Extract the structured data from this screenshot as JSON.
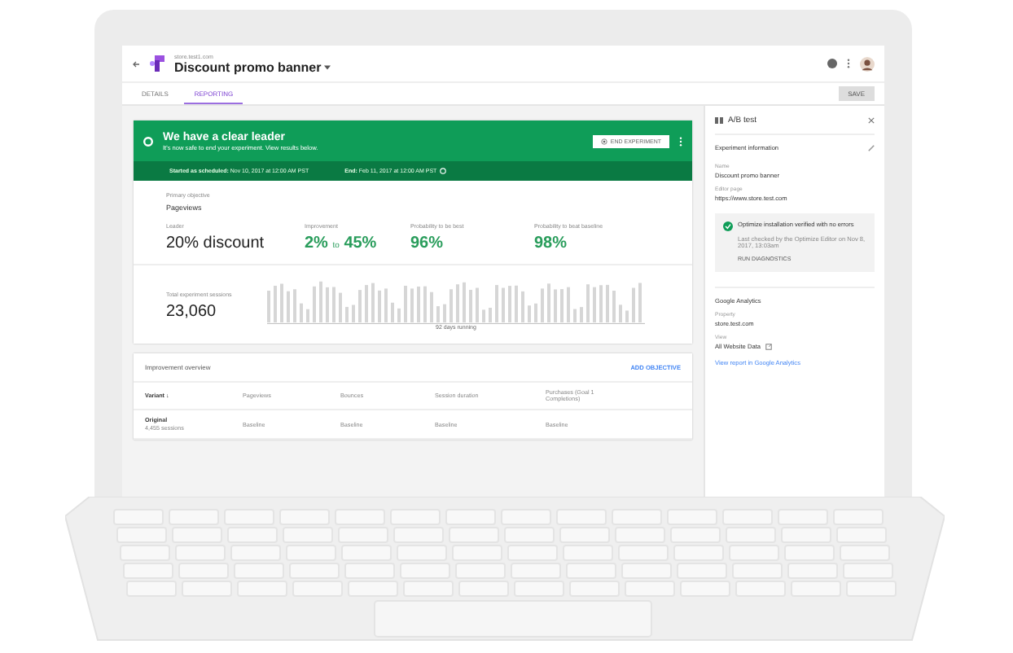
{
  "header": {
    "site": "store.test1.com",
    "title": "Discount promo banner"
  },
  "tabs": [
    {
      "label": "DETAILS",
      "selected": false
    },
    {
      "label": "REPORTING",
      "selected": true
    }
  ],
  "save_button": "SAVE",
  "status_banner": {
    "title": "We have a clear leader",
    "subtitle": "It's now safe to end your experiment. View results below.",
    "end_button": "END EXPERIMENT",
    "started_label": "Started as scheduled:",
    "started": "Nov 10, 2017 at 12:00 AM PST",
    "end_label": "End:",
    "end": "Feb 11, 2017 at 12:00 AM PST"
  },
  "summary": {
    "objective_label": "Primary objective",
    "objective": "Pageviews",
    "leader_label": "Leader",
    "leader": "20% discount",
    "improvement_label": "Improvement",
    "improvement_low": "2%",
    "improvement_joiner": "to",
    "improvement_high": "45%",
    "best_label": "Probability to be best",
    "best": "96%",
    "beat_label": "Probability to beat baseline",
    "beat": "98%",
    "sessions_label": "Total experiment sessions",
    "sessions": "23,060",
    "days": "92 days running"
  },
  "overview": {
    "title": "Improvement overview",
    "action": "ADD OBJECTIVE",
    "columns": [
      "Variant ↓",
      "Pageviews",
      "Bounces",
      "Session duration",
      "Purchases (Goal 1 Completions)"
    ],
    "rows": [
      {
        "cells": [
          "Original",
          "Baseline",
          "Baseline",
          "Baseline",
          "Baseline"
        ],
        "sessions": "4,455 sessions"
      }
    ]
  },
  "side_panel": {
    "title": "A/B test",
    "section": "Experiment information",
    "fields": [
      {
        "label": "Name",
        "value": "Discount promo banner"
      },
      {
        "label": "Editor page",
        "value": "https://www.store.test.com"
      }
    ],
    "install_status": "Optimize installation verified with no errors",
    "last_checked": "Last checked by the Optimize Editor on Nov 8, 2017, 13:03am",
    "diagnostics": "RUN DIAGNOSTICS",
    "analytics_title": "Google Analytics",
    "property_label": "Property",
    "property": "store.test.com",
    "view_label": "View",
    "view": "All Website Data",
    "report_link": "View report in Google Analytics"
  }
}
